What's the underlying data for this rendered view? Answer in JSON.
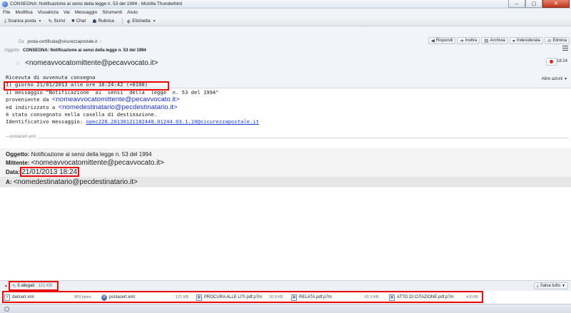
{
  "window": {
    "title": "CONSEGNA: Notificazione ai sensi della legge n. 53 del 1994 - Mozilla Thunderbird",
    "minimize": "–",
    "maximize": "▢",
    "close": "✕"
  },
  "menubar": [
    "File",
    "Modifica",
    "Visualizza",
    "Vai",
    "Messaggio",
    "Strumenti",
    "Aiuto"
  ],
  "toolbar": {
    "download": "Scarica posta",
    "write": "Scrivi",
    "chat": "Chat",
    "address_book": "Rubrica",
    "tag": "Etichetta"
  },
  "header": {
    "from_label": "Da",
    "from_value": "posta-certificata@sicurezzapostale.it",
    "subject_label": "Oggetto",
    "subject_value": "CONSEGNA: Notificazione ai sensi della legge n. 53 del 1994",
    "to_value": "<nomeavvocatomittente@pecavvocato.it>",
    "time": "18:24",
    "more_actions": "Altre azioni",
    "actions": {
      "reply": "Rispondi",
      "forward": "Inoltra",
      "archive": "Archivia",
      "junk": "Indesiderata",
      "delete": "Elimina"
    }
  },
  "body": {
    "line1": "Ricevuta di avvenuta consegna",
    "line2": "Il giorno 21/01/2013 alle ore 18:24:42 (+0100)",
    "line3": "il messaggio \"Notificazione  ai  sensi  della  legge  n. 53 del 1994\"",
    "line4_prefix": "proveniente da ",
    "line4_addr": "<nomeavvocatomittente@pecavvocato.it>",
    "line5_prefix": "ed indirizzato a ",
    "line5_addr": "<nomedestinatario@pecdestinatario.it>",
    "line6": "è stato consegnato nella casella di destinazione.",
    "line7_prefix": "Identificativo messaggio: ",
    "line7_link": "opec228.20130121182440.01244.03.1.10@sicurezzapostale.it"
  },
  "separator": "postacert.eml",
  "forwarded": {
    "subject_label": "Oggetto:",
    "subject_value": "Notificazione ai sensi della legge n. 53 del 1994",
    "sender_label": "Mittente:",
    "sender_value": "<nomeavvocatomittente@pecavvocato.it>",
    "date_label": "Data:",
    "date_value": "21/01/2013 18:24",
    "to_label": "A:",
    "to_value": "<nomedestinatario@pecdestinatario.it>"
  },
  "attachments": {
    "count_label": "5 allegati",
    "total_size": "121 KB",
    "save_all": "Salva tutto",
    "items": [
      {
        "name": "daticert.xml",
        "size": "903 bytes"
      },
      {
        "name": "postacert.eml",
        "size": "121 KB"
      },
      {
        "name": "PROCURA ALLE LITI.pdf.p7m",
        "size": "20.9 KB"
      },
      {
        "name": "RELATA.pdf.p7m",
        "size": "61.0 KB"
      },
      {
        "name": "ATTO DI CITAZIONE.pdf.p7m",
        "size": "4.8 KB"
      }
    ]
  },
  "colors": {
    "highlight_box": "#ee0000",
    "link": "#1a3fd6"
  }
}
